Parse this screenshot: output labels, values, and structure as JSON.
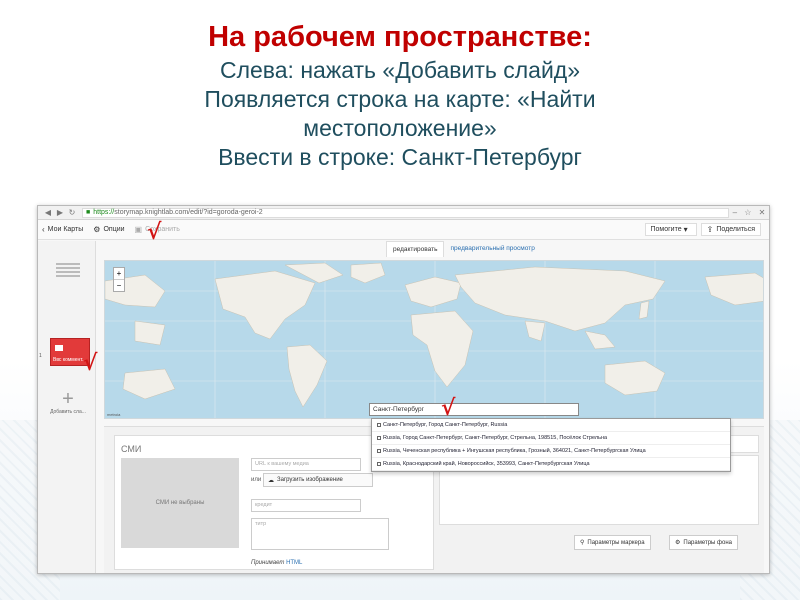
{
  "title": {
    "main": "На рабочем пространстве:",
    "lines": [
      "Слева: нажать «Добавить слайд»",
      "Появляется строка на карте: «Найти",
      "местоположение»",
      "Ввести в строке: Санкт-Петербург"
    ]
  },
  "browser": {
    "url_scheme": "https://",
    "url_rest": "storymap.knightlab.com/edit/?id=goroda-geroi-2"
  },
  "toolbar": {
    "my_maps": "Мои Карты",
    "options": "Опции",
    "save": "Сохранить",
    "help": "Помогите",
    "share": "Поделиться"
  },
  "tabs": {
    "edit": "редактировать",
    "preview": "предварительный просмотр"
  },
  "sidebar": {
    "slide_number": "1",
    "slide_caption": "Ввс коммент...",
    "add_slide": "Добавить сла..."
  },
  "map": {
    "zoom_in": "+",
    "zoom_out": "−",
    "attribution": "metroia",
    "search_value": "Санкт-Петербург"
  },
  "search_results": [
    "Санкт-Петербург, Город Санкт-Петербург, Russia",
    "Russia, Город Санкт-Петербург, Санкт-Петербург, Стрельна, 198515, Посёлок Стрельна",
    "Russia, Чеченская республика + Ингушская республика, Грозный, 364021, Санкт-Петербургская Улица",
    "Russia, Краснодарский край, Новороссийск, 353993, Санкт-Петербургская Улица"
  ],
  "media": {
    "title": "СМИ",
    "placeholder": "СМИ не выбраны",
    "url_placeholder": "URL к вашему медиа",
    "or": "или",
    "upload": "Загрузить изображение",
    "credit_placeholder": "кредит",
    "caption_placeholder": "титр",
    "accepts_prefix": "Принимает",
    "accepts_link": "HTML"
  },
  "buttons": {
    "marker_params": "Параметры маркера",
    "background_params": "Параметры фона"
  },
  "annotations": {
    "checkmark": "√"
  },
  "colors": {
    "title_red": "#c00000",
    "title_text": "#1f4e5e",
    "slide_red": "#e23a3a",
    "map_water": "#b7d9ea",
    "map_land": "#f1efe9"
  }
}
